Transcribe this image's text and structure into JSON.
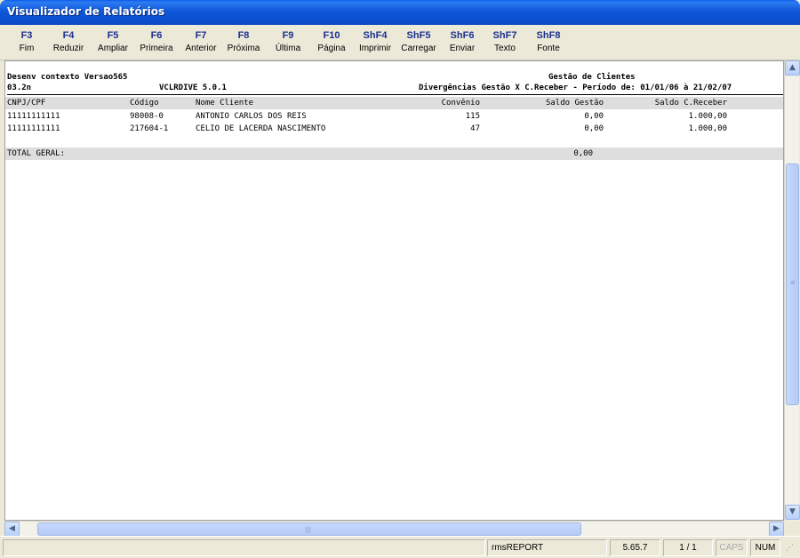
{
  "window": {
    "title": "Visualizador de Relatórios"
  },
  "toolbar": [
    {
      "key": "F3",
      "label": "Fim"
    },
    {
      "key": "F4",
      "label": "Reduzir"
    },
    {
      "key": "F5",
      "label": "Ampliar"
    },
    {
      "key": "F6",
      "label": "Primeira"
    },
    {
      "key": "F7",
      "label": "Anterior"
    },
    {
      "key": "F8",
      "label": "Próxima"
    },
    {
      "key": "F9",
      "label": "Última"
    },
    {
      "key": "F10",
      "label": "Página"
    },
    {
      "key": "ShF4",
      "label": "Imprimir"
    },
    {
      "key": "ShF5",
      "label": "Carregar"
    },
    {
      "key": "ShF6",
      "label": "Enviar"
    },
    {
      "key": "ShF7",
      "label": "Texto"
    },
    {
      "key": "ShF8",
      "label": "Fonte"
    }
  ],
  "report": {
    "header_left_1": "Desenv contexto Versao565",
    "header_left_2": "03.2n",
    "header_mid_2": "VCLRDIVE 5.0.1",
    "header_right_1": "Gestão de Clientes",
    "header_right_2": "Divergências Gestão X C.Receber - Período de: 01/01/06 à 21/02/07",
    "columns": {
      "cnpj": "CNPJ/CPF",
      "codigo": "Código",
      "nome": "Nome Cliente",
      "convenio": "Convênio",
      "saldo_gestao": "Saldo Gestão",
      "saldo_receber": "Saldo C.Receber"
    },
    "rows": [
      {
        "cnpj": "11111111111",
        "codigo": "98008-0",
        "nome": "ANTONIO CARLOS DOS REIS",
        "convenio": "115",
        "saldo_gestao": "0,00",
        "saldo_receber": "1.000,00"
      },
      {
        "cnpj": "11111111111",
        "codigo": "217604-1",
        "nome": "CELIO DE LACERDA NASCIMENTO",
        "convenio": "47",
        "saldo_gestao": "0,00",
        "saldo_receber": "1.000,00"
      }
    ],
    "total_label": "TOTAL GERAL:",
    "total_value": "0,00"
  },
  "statusbar": {
    "app": "rmsREPORT",
    "version": "5.65.7",
    "page": "1 / 1",
    "caps": "CAPS",
    "num": "NUM"
  }
}
